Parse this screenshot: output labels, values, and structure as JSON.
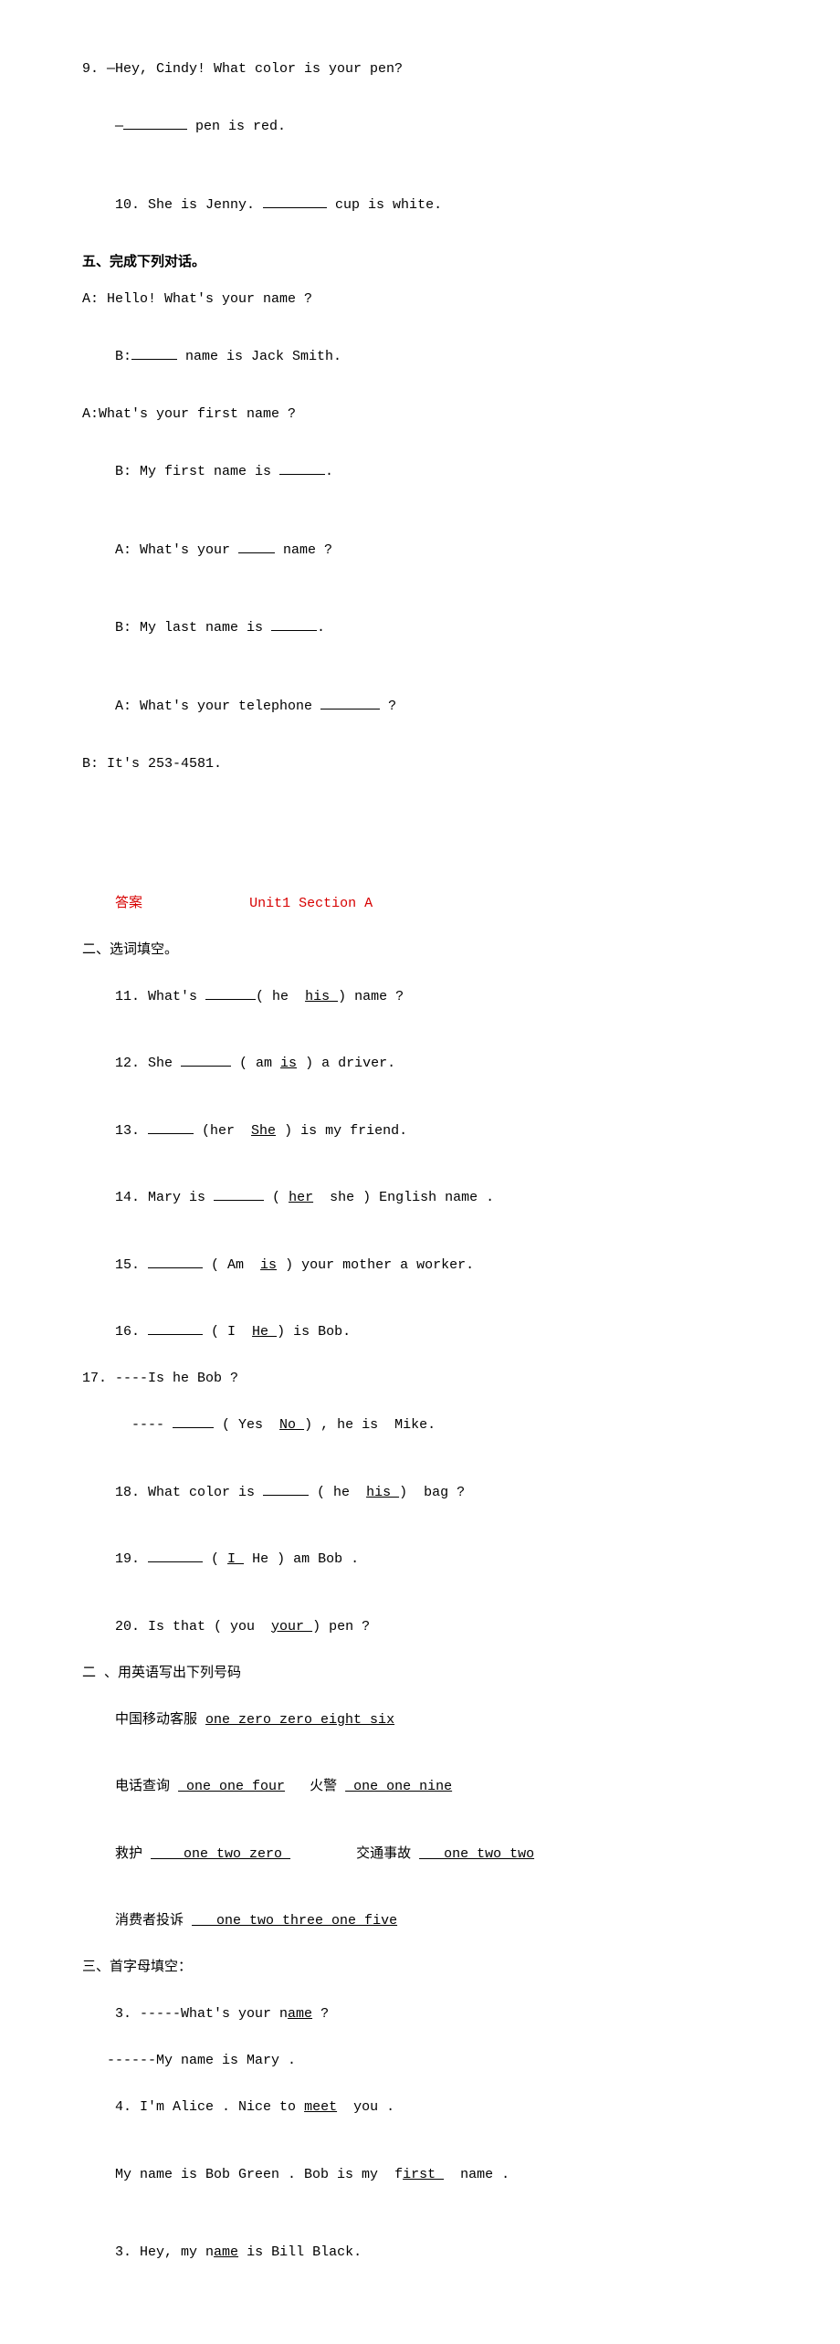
{
  "top": {
    "q9a": "9. —Hey, Cindy! What color is your pen?",
    "q9b_prefix": "—",
    "q9b_suffix": " pen is red.",
    "q10_prefix": "10. She is Jenny. ",
    "q10_suffix": " cup is white.",
    "sec5_heading": "五、完成下列对话。",
    "d1": "A: Hello! What's your name ?",
    "d2_prefix": "B:",
    "d2_suffix": " name is Jack Smith.",
    "d3": "A:What's your first name ?",
    "d4_prefix": "B: My first name is ",
    "d4_suffix": ".",
    "d5_prefix": "A: What's your ",
    "d5_suffix": " name ?",
    "d6_prefix": "B: My last name is ",
    "d6_suffix": ".",
    "d7_prefix": "A: What's your telephone ",
    "d7_suffix": " ?",
    "d8": "B: It's 253-4581."
  },
  "answers": {
    "label": "答案",
    "title": "Unit1 Section A",
    "sec2_heading": "二、选词填空。",
    "l11a": "11. What's ",
    "l11b": "( he  ",
    "l11u": "his ",
    "l11c": ") name ?",
    "l12a": "12. She ",
    "l12b": " ( am ",
    "l12u": "is",
    "l12c": " ) a driver.",
    "l13a": "13. ",
    "l13b": " (her  ",
    "l13u": "She",
    "l13c": " ) is my friend.",
    "l14a": "14. Mary is ",
    "l14b": " ( ",
    "l14u": "her",
    "l14c": "  she ) English name .",
    "l15a": "15. ",
    "l15b": " ( Am  ",
    "l15u": "is",
    "l15c": " ) your mother a worker.",
    "l16a": "16. ",
    "l16b": " ( I  ",
    "l16u": "He ",
    "l16c": ") is Bob.",
    "l17a": "17. ----Is he Bob ?",
    "l17b_a": "  ---- ",
    "l17b_b": " ( Yes  ",
    "l17b_u": "No ",
    "l17b_c": ") , he is  Mike.",
    "l18a": "18. What color is ",
    "l18b": " ( he  ",
    "l18u": "his ",
    "l18c": ")  bag ?",
    "l19a": "19. ",
    "l19b": " ( ",
    "l19u": "I ",
    "l19c": " He ) am Bob .",
    "l20a": "20. Is that ( you  ",
    "l20u": "your ",
    "l20b": ") pen ?",
    "sec2b_heading": "二 、用英语写出下列号码",
    "n1a": "中国移动客服 ",
    "n1u": "one zero zero eight six",
    "n2a": "电话查询 ",
    "n2u": " one one four",
    "n2b": "   火警 ",
    "n2u2": " one one nine",
    "n3a": "救护 ",
    "n3u": "    one two zero ",
    "n3b": "        交通事故 ",
    "n3u2": "   one two two",
    "n4a": "消费者投诉 ",
    "n4u": "   one two three one five",
    "sec3_heading": "三、首字母填空：",
    "s3_3a": "3. -----What's your n",
    "s3_3u": "ame",
    "s3_3b": " ?",
    "s3_3c": "   ------My name is Mary .",
    "s3_4a": "4. I'm Alice . Nice to ",
    "s3_4u": "meet",
    "s3_4b": "  you .",
    "s3_5a": "My name is Bob Green . Bob is my  f",
    "s3_5u": "irst ",
    "s3_5b": "  name .",
    "s3_6a": "3. Hey, my n",
    "s3_6u": "ame",
    "s3_6b": " is Bill Black."
  }
}
